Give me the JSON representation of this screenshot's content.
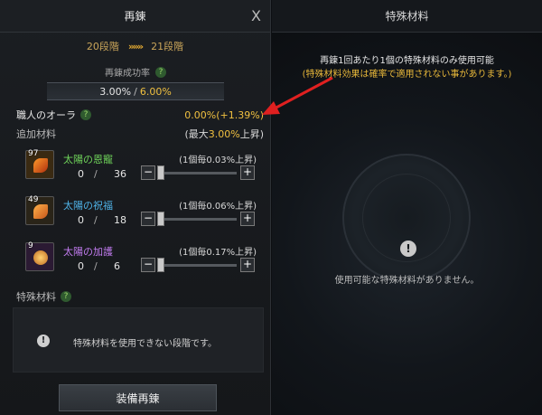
{
  "left_panel": {
    "title": "再錬",
    "close_symbol": "X",
    "stage_from": "20段階",
    "stage_arrows": "»»»",
    "stage_to": "21段階",
    "rate_label": "再錬成功率",
    "rate_current": "3.00%",
    "rate_separator": "/",
    "rate_max": "6.00%",
    "aura_label": "職人のオーラ",
    "aura_value": "0.00%(+1.39%)",
    "extra_label": "追加材料",
    "extra_max_prefix": "(最大",
    "extra_max_value": "3.00%",
    "extra_max_suffix": "上昇)",
    "materials": [
      {
        "name": "太陽の恩寵",
        "color": "#6fd35a",
        "owned": "97",
        "per": "(1個毎0.03%上昇)",
        "qty": "0",
        "max": "36",
        "icon": "sun-grace-icon"
      },
      {
        "name": "太陽の祝福",
        "color": "#4fb3e8",
        "owned": "49",
        "per": "(1個毎0.06%上昇)",
        "qty": "0",
        "max": "18",
        "icon": "sun-blessing-icon"
      },
      {
        "name": "太陽の加護",
        "color": "#c27cf0",
        "owned": "9",
        "per": "(1個毎0.17%上昇)",
        "qty": "0",
        "max": "6",
        "icon": "sun-protection-icon"
      }
    ],
    "special_label": "特殊材料",
    "special_message": "特殊材料を使用できない段階です。",
    "equip_button": "装備再錬"
  },
  "right_panel": {
    "title": "特殊材料",
    "note1": "再錬1回あたり1個の特殊材料のみ使用可能",
    "note2": "(特殊材料効果は確率で適用されない事があります。)",
    "empty_message": "使用可能な特殊材料がありません。"
  },
  "colors": {
    "accent_gold": "#f0c040",
    "annotation_arrow": "#e02020"
  }
}
